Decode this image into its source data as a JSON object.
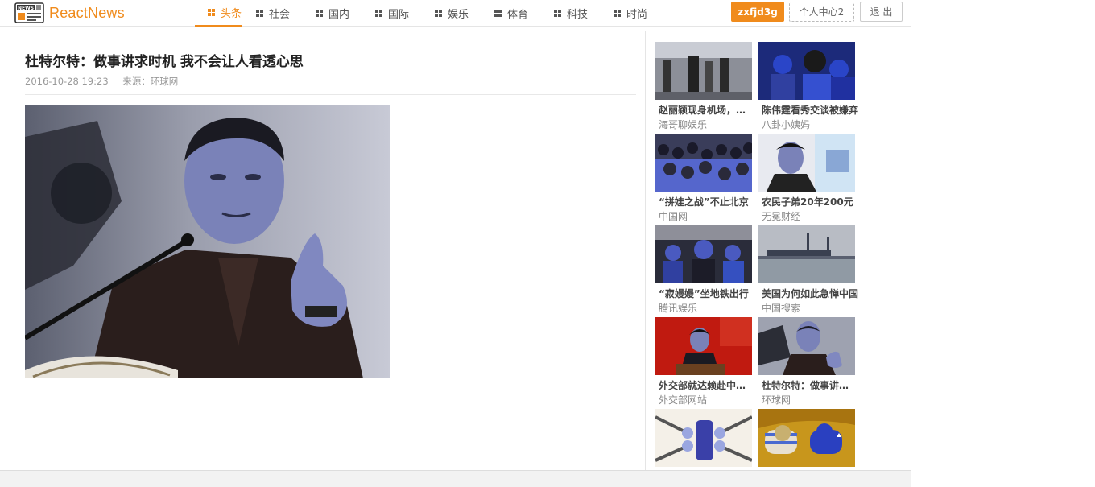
{
  "app": {
    "logo_badge": "NEWS",
    "name": "ReactNews"
  },
  "nav": [
    {
      "label": "头条",
      "active": true
    },
    {
      "label": "社会",
      "active": false
    },
    {
      "label": "国内",
      "active": false
    },
    {
      "label": "国际",
      "active": false
    },
    {
      "label": "娱乐",
      "active": false
    },
    {
      "label": "体育",
      "active": false
    },
    {
      "label": "科技",
      "active": false
    },
    {
      "label": "时尚",
      "active": false
    }
  ],
  "user": {
    "username": "zxfjd3g",
    "center_label": "个人中心2",
    "logout_label": "退 出"
  },
  "article": {
    "title": "杜特尔特：做事讲求时机 我不会让人看透心思",
    "date": "2016-10-28 19:23",
    "source": "来源：环球网"
  },
  "sidebar": {
    "cards": [
      {
        "title": "赵丽颖现身机场，瘦成一道闪电",
        "source": "海哥聊娱乐"
      },
      {
        "title": "陈伟霆看秀交谈被嫌弃",
        "source": "八卦小姨妈"
      },
      {
        "title": "“拼娃之战”不止北京",
        "source": "中国网"
      },
      {
        "title": "农民子弟20年200元",
        "source": "无冕财经"
      },
      {
        "title": "“寂嫚嫚”坐地铁出行",
        "source": "腾讯娱乐"
      },
      {
        "title": "美国为何如此急惮中国",
        "source": "中国搜索"
      },
      {
        "title": "外交部就达赖赴中印边境",
        "source": "外交部网站"
      },
      {
        "title": "杜特尔特：做事讲求时机",
        "source": "环球网"
      },
      {
        "title": "",
        "source": ""
      },
      {
        "title": "",
        "source": ""
      }
    ]
  },
  "colors": {
    "accent": "#f08b1c",
    "text": "#333333",
    "muted": "#999999"
  }
}
